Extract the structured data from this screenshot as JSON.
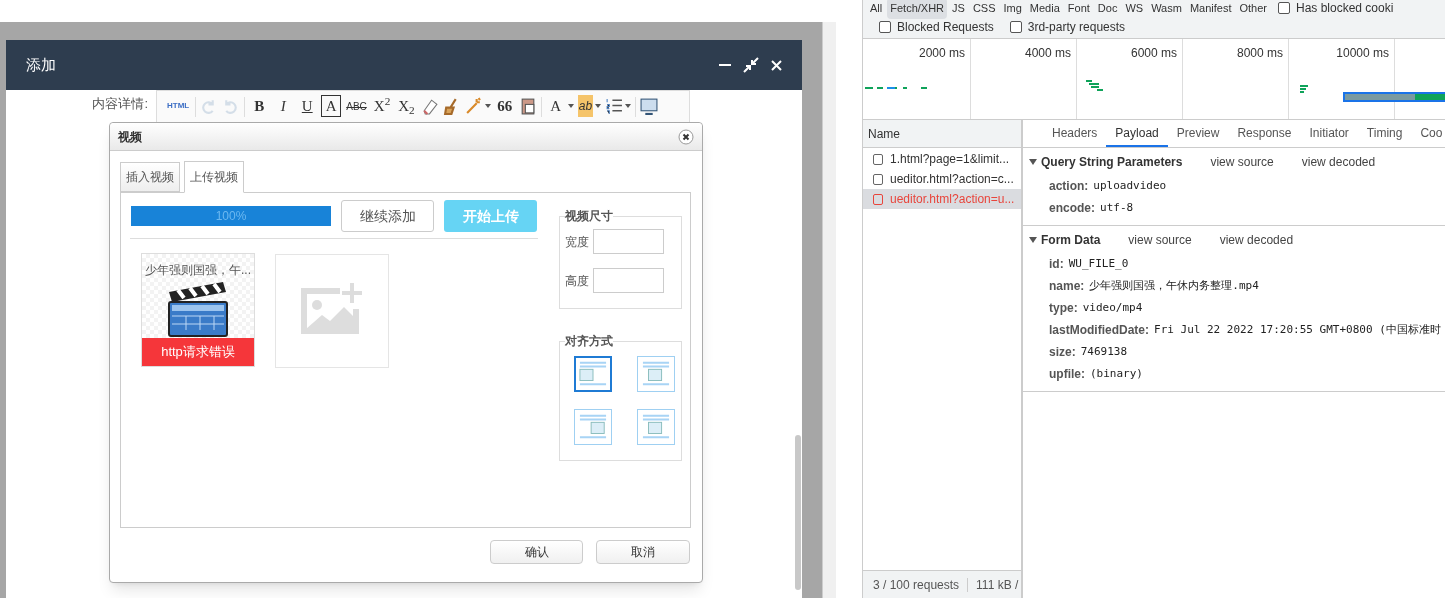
{
  "modal": {
    "title": "添加",
    "field_label": "内容详情:",
    "toolbar": [
      {
        "kind": "text",
        "text": "HTML"
      },
      {
        "kind": "icon",
        "disabled": true
      },
      {
        "kind": "icon",
        "disabled": true
      },
      {
        "kind": "text",
        "text": "B"
      },
      {
        "kind": "text",
        "text": "I"
      },
      {
        "kind": "text",
        "text": "U"
      },
      {
        "kind": "text",
        "text": "A"
      },
      {
        "kind": "text",
        "text": "ABC"
      },
      {
        "kind": "text",
        "text": "X$^{2}$"
      },
      {
        "kind": "text",
        "text": "X$_{2}$"
      },
      {
        "kind": "icon",
        "disabled": false
      },
      {
        "kind": "icon",
        "disabled": false
      },
      {
        "kind": "icon",
        "disabled": false
      },
      {
        "kind": "text",
        "text": "66"
      },
      {
        "kind": "icon",
        "disabled": false
      },
      {
        "kind": "text",
        "text": "A"
      },
      {
        "kind": "text",
        "text": "ab"
      },
      {
        "kind": "icon",
        "disabled": false
      },
      {
        "kind": "icon",
        "disabled": false
      }
    ]
  },
  "video_dialog": {
    "title": "视频",
    "tabs": [
      {
        "label": "插入视频",
        "selected": false
      },
      {
        "label": "上传视频",
        "selected": true
      }
    ],
    "progress": {
      "level": 1,
      "text": "100%"
    },
    "buttons": [
      "继续添加",
      "开始上传"
    ],
    "file": {
      "name": "少年强则国强，午...",
      "error": "http请求错误"
    },
    "size_group": {
      "title": "视频尺寸",
      "fields": [
        {
          "label": "宽度"
        },
        {
          "label": "高度"
        }
      ]
    },
    "align_group": {
      "title": "对齐方式",
      "options": [
        {
          "selected": true
        },
        {
          "selected": false
        },
        {
          "selected": false
        },
        {
          "selected": false
        }
      ]
    },
    "footer_buttons": [
      "确认",
      "取消"
    ]
  },
  "devtools": {
    "filters": [
      {
        "label": "All",
        "selected": false
      },
      {
        "label": "Fetch/XHR",
        "selected": true
      },
      {
        "label": "JS",
        "selected": false
      },
      {
        "label": "CSS",
        "selected": false
      },
      {
        "label": "Img",
        "selected": false
      },
      {
        "label": "Media",
        "selected": false
      },
      {
        "label": "Font",
        "selected": false
      },
      {
        "label": "Doc",
        "selected": false
      },
      {
        "label": "WS",
        "selected": false
      },
      {
        "label": "Wasm",
        "selected": false
      },
      {
        "label": "Manifest",
        "selected": false
      },
      {
        "label": "Other",
        "selected": false
      }
    ],
    "checkboxes_row1": [
      {
        "label": "Has blocked cooki",
        "checked": false
      }
    ],
    "checkboxes_row2": [
      {
        "label": "Blocked Requests",
        "checked": false
      },
      {
        "label": "3rd-party requests",
        "checked": false
      }
    ],
    "timeline_ticks": [
      "2000 ms",
      "4000 ms",
      "6000 ms",
      "8000 ms",
      "10000 ms"
    ],
    "name_header": "Name",
    "requests": [
      {
        "name": "1.html?page=1&limit...",
        "error": false,
        "selected": false
      },
      {
        "name": "ueditor.html?action=c...",
        "error": false,
        "selected": false
      },
      {
        "name": "ueditor.html?action=u...",
        "error": true,
        "selected": true
      }
    ],
    "detail_tabs": [
      {
        "label": "Headers",
        "selected": false
      },
      {
        "label": "Payload",
        "selected": true
      },
      {
        "label": "Preview",
        "selected": false
      },
      {
        "label": "Response",
        "selected": false
      },
      {
        "label": "Initiator",
        "selected": false
      },
      {
        "label": "Timing",
        "selected": false
      },
      {
        "label": "Coo",
        "selected": false
      }
    ],
    "sections": [
      {
        "title": "Query String Parameters",
        "expanded": true,
        "links": [
          "view source",
          "view decoded"
        ],
        "params": [
          {
            "key": "action:",
            "value": "uploadvideo"
          },
          {
            "key": "encode:",
            "value": "utf-8"
          }
        ]
      },
      {
        "title": "Form Data",
        "expanded": true,
        "links": [
          "view source",
          "view decoded"
        ],
        "params": [
          {
            "key": "id:",
            "value": "WU_FILE_0"
          },
          {
            "key": "name:",
            "value": "少年强则国强，午休内务整理.mp4"
          },
          {
            "key": "type:",
            "value": "video/mp4"
          },
          {
            "key": "lastModifiedDate:",
            "value": "Fri Jul 22 2022 17:20:55 GMT+0800 (中国标准时"
          },
          {
            "key": "size:",
            "value": "7469138"
          },
          {
            "key": "upfile:",
            "value": "(binary)"
          }
        ]
      }
    ],
    "status": [
      "3 / 100 requests",
      "111 kB /"
    ]
  }
}
